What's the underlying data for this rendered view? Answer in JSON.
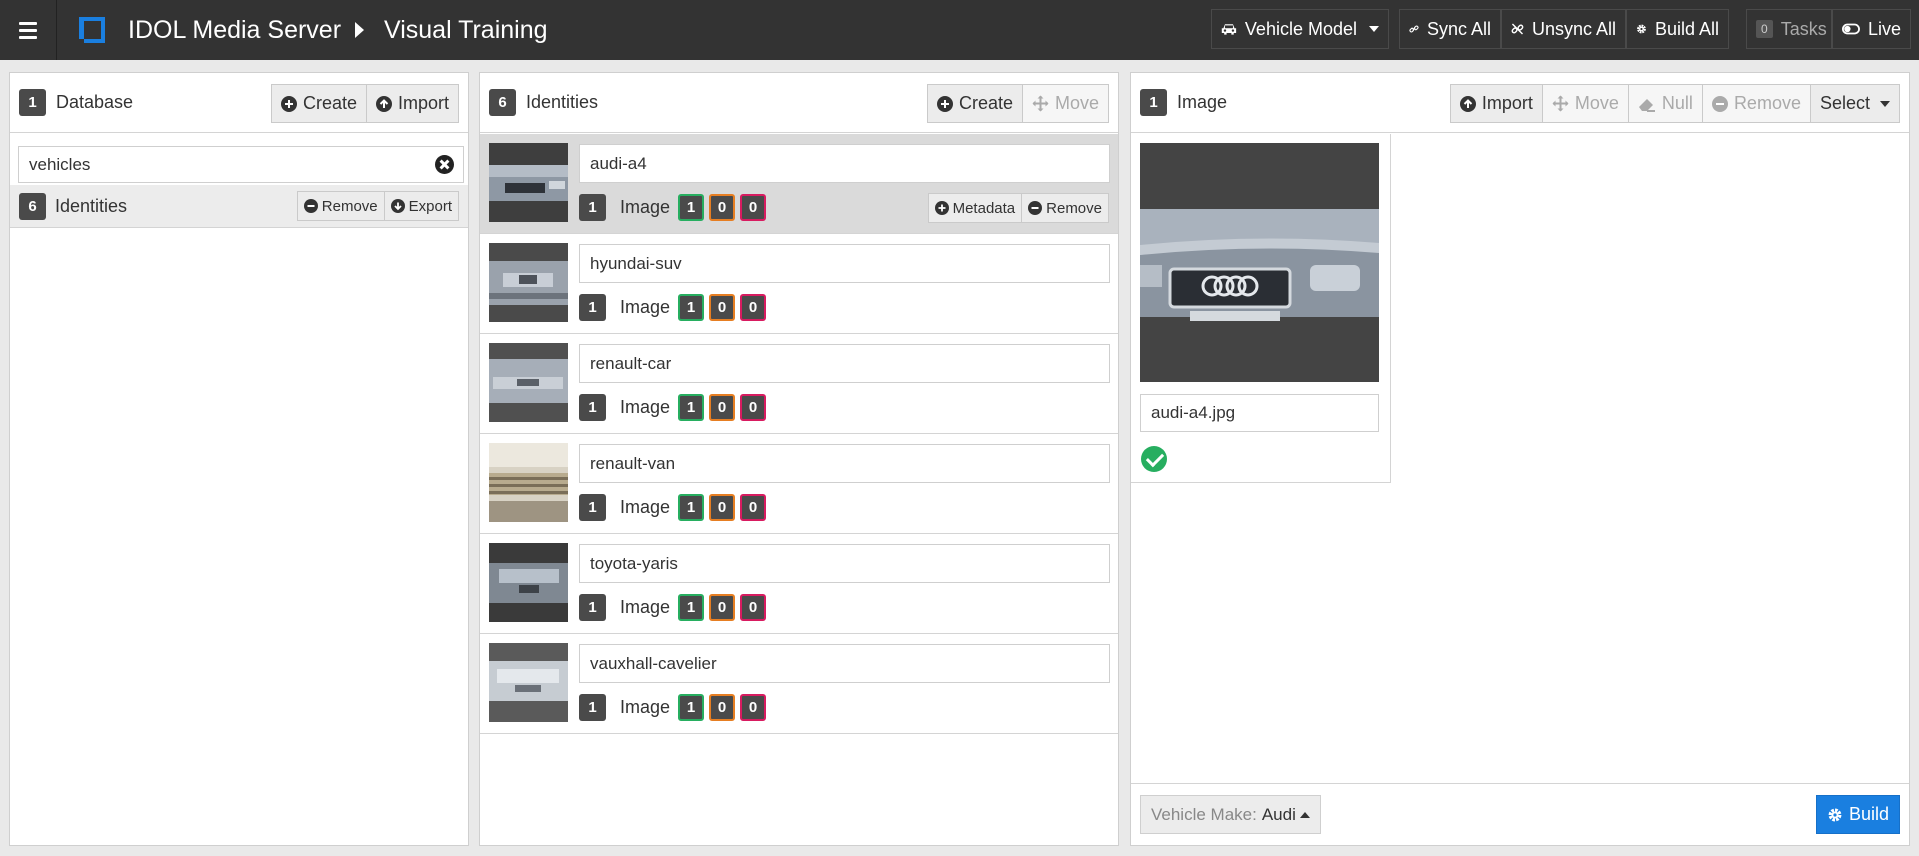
{
  "topbar": {
    "app_title": "IDOL Media Server",
    "breadcrumb": "Visual Training",
    "analysis_select": "Vehicle Model",
    "sync_all": "Sync All",
    "unsync_all": "Unsync All",
    "build_all": "Build All",
    "tasks_count": "0",
    "tasks_label": "Tasks",
    "live_label": "Live"
  },
  "database_panel": {
    "count": "1",
    "title": "Database",
    "create_label": "Create",
    "import_label": "Import",
    "search_value": "vehicles",
    "db_identity_count": "6",
    "db_identity_label": "Identities",
    "remove_label": "Remove",
    "export_label": "Export"
  },
  "identities_panel": {
    "count": "6",
    "title": "Identities",
    "create_label": "Create",
    "move_label": "Move",
    "metadata_label": "Metadata",
    "remove_label": "Remove",
    "items": [
      {
        "name": "audi-a4",
        "image_count": "1",
        "image_label": "Image",
        "trained": "1",
        "pending": "0",
        "failed": "0"
      },
      {
        "name": "hyundai-suv",
        "image_count": "1",
        "image_label": "Image",
        "trained": "1",
        "pending": "0",
        "failed": "0"
      },
      {
        "name": "renault-car",
        "image_count": "1",
        "image_label": "Image",
        "trained": "1",
        "pending": "0",
        "failed": "0"
      },
      {
        "name": "renault-van",
        "image_count": "1",
        "image_label": "Image",
        "trained": "1",
        "pending": "0",
        "failed": "0"
      },
      {
        "name": "toyota-yaris",
        "image_count": "1",
        "image_label": "Image",
        "trained": "1",
        "pending": "0",
        "failed": "0"
      },
      {
        "name": "vauxhall-cavelier",
        "image_count": "1",
        "image_label": "Image",
        "trained": "1",
        "pending": "0",
        "failed": "0"
      }
    ]
  },
  "image_panel": {
    "count": "1",
    "title": "Image",
    "import_label": "Import",
    "move_label": "Move",
    "null_label": "Null",
    "remove_label": "Remove",
    "select_label": "Select",
    "file_name": "audi-a4.jpg",
    "make_label": "Vehicle Make:",
    "make_value": "Audi",
    "build_label": "Build"
  },
  "colors": {
    "topbar": "#333333",
    "accent_blue": "#1a7fe0",
    "trained_green": "#27ae60",
    "pending_orange": "#e67e22",
    "failed_pink": "#d81b60"
  }
}
